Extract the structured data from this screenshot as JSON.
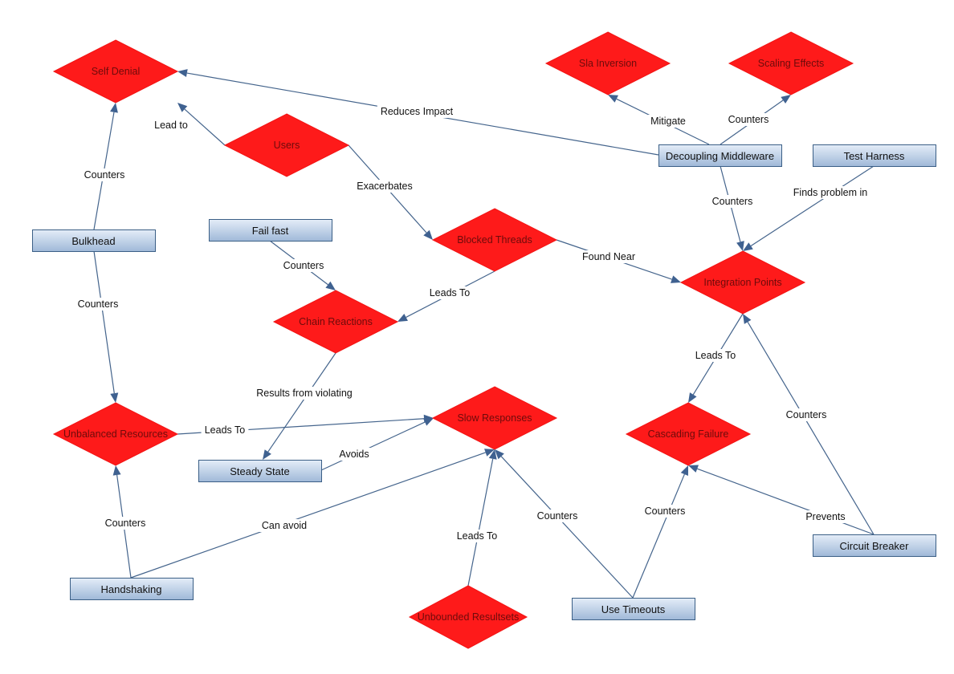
{
  "diagram": {
    "colors": {
      "problem_fill": "#fe1a1a",
      "problem_text": "#6d0b0b",
      "pattern_fill_top": "#e4edf8",
      "pattern_fill_bottom": "#9fb8d8",
      "pattern_border": "#3b5f86",
      "edge": "#44648c"
    },
    "nodes": [
      {
        "id": "self-denial",
        "label": "Self Denial",
        "kind": "problem"
      },
      {
        "id": "users",
        "label": "Users",
        "kind": "problem"
      },
      {
        "id": "sla-inversion",
        "label": "Sla Inversion",
        "kind": "problem"
      },
      {
        "id": "scaling-effects",
        "label": "Scaling Effects",
        "kind": "problem"
      },
      {
        "id": "blocked-threads",
        "label": "Blocked Threads",
        "kind": "problem"
      },
      {
        "id": "integration-points",
        "label": "Integration Points",
        "kind": "problem"
      },
      {
        "id": "chain-reactions",
        "label": "Chain Reactions",
        "kind": "problem"
      },
      {
        "id": "unbalanced-resources",
        "label": "Unbalanced Resources",
        "kind": "problem"
      },
      {
        "id": "slow-responses",
        "label": "Slow Responses",
        "kind": "problem"
      },
      {
        "id": "cascading-failure",
        "label": "Cascading Failure",
        "kind": "problem"
      },
      {
        "id": "unbounded-resultsets",
        "label": "Unbounded Resultsets",
        "kind": "problem"
      },
      {
        "id": "bulkhead",
        "label": "Bulkhead",
        "kind": "pattern"
      },
      {
        "id": "fail-fast",
        "label": "Fail fast",
        "kind": "pattern"
      },
      {
        "id": "decoupling-middleware",
        "label": "Decoupling Middleware",
        "kind": "pattern"
      },
      {
        "id": "test-harness",
        "label": "Test Harness",
        "kind": "pattern"
      },
      {
        "id": "steady-state",
        "label": "Steady State",
        "kind": "pattern"
      },
      {
        "id": "handshaking",
        "label": "Handshaking",
        "kind": "pattern"
      },
      {
        "id": "use-timeouts",
        "label": "Use Timeouts",
        "kind": "pattern"
      },
      {
        "id": "circuit-breaker",
        "label": "Circuit Breaker",
        "kind": "pattern"
      }
    ],
    "edges": [
      {
        "from": "users",
        "to": "self-denial",
        "label": "Lead to"
      },
      {
        "from": "decoupling-middleware",
        "to": "self-denial",
        "label": "Reduces Impact"
      },
      {
        "from": "bulkhead",
        "to": "self-denial",
        "label": "Counters"
      },
      {
        "from": "decoupling-middleware",
        "to": "sla-inversion",
        "label": "Mitigate"
      },
      {
        "from": "decoupling-middleware",
        "to": "scaling-effects",
        "label": "Counters"
      },
      {
        "from": "users",
        "to": "blocked-threads",
        "label": "Exacerbates"
      },
      {
        "from": "decoupling-middleware",
        "to": "integration-points",
        "label": "Counters"
      },
      {
        "from": "test-harness",
        "to": "integration-points",
        "label": "Finds problem in"
      },
      {
        "from": "blocked-threads",
        "to": "integration-points",
        "label": "Found Near"
      },
      {
        "from": "fail-fast",
        "to": "chain-reactions",
        "label": "Counters"
      },
      {
        "from": "blocked-threads",
        "to": "chain-reactions",
        "label": "Leads To"
      },
      {
        "from": "bulkhead",
        "to": "unbalanced-resources",
        "label": "Counters"
      },
      {
        "from": "chain-reactions",
        "to": "steady-state",
        "label": "Results from violating"
      },
      {
        "from": "unbalanced-resources",
        "to": "slow-responses",
        "label": "Leads To"
      },
      {
        "from": "steady-state",
        "to": "slow-responses",
        "label": "Avoids"
      },
      {
        "from": "integration-points",
        "to": "cascading-failure",
        "label": "Leads To"
      },
      {
        "from": "circuit-breaker",
        "to": "integration-points",
        "label": "Counters"
      },
      {
        "from": "handshaking",
        "to": "unbalanced-resources",
        "label": "Counters"
      },
      {
        "from": "handshaking",
        "to": "slow-responses",
        "label": "Can avoid"
      },
      {
        "from": "unbounded-resultsets",
        "to": "slow-responses",
        "label": "Leads To"
      },
      {
        "from": "use-timeouts",
        "to": "slow-responses",
        "label": "Counters"
      },
      {
        "from": "use-timeouts",
        "to": "cascading-failure",
        "label": "Counters"
      },
      {
        "from": "circuit-breaker",
        "to": "cascading-failure",
        "label": "Prevents"
      }
    ]
  }
}
